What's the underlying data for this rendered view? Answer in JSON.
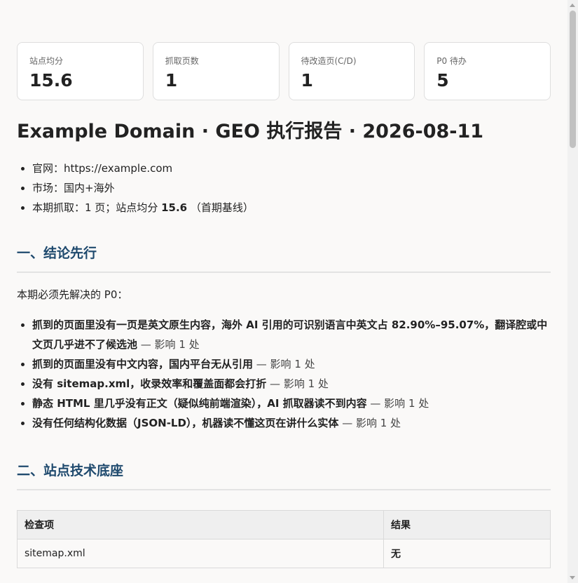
{
  "stats": [
    {
      "label": "站点均分",
      "value": "15.6"
    },
    {
      "label": "抓取页数",
      "value": "1"
    },
    {
      "label": "待改造页(C/D)",
      "value": "1"
    },
    {
      "label": "P0 待办",
      "value": "5"
    }
  ],
  "title": "Example Domain · GEO 执行报告 · 2026-08-11",
  "meta": {
    "site": "官网：https://example.com",
    "market": "市场：国内+海外",
    "crawl_prefix": "本期抓取：1 页；站点均分 ",
    "crawl_score": "15.6",
    "crawl_suffix": " （首期基线）"
  },
  "section1": {
    "heading": "一、结论先行",
    "intro": "本期必须先解决的 P0：",
    "items": [
      {
        "text": "抓到的页面里没有一页是英文原生内容，海外 AI 引用的可识别语言中英文占 82.90%–95.07%，翻译腔或中文页几乎进不了候选池",
        "impact": " — 影响 1 处"
      },
      {
        "text": "抓到的页面里没有中文内容，国内平台无从引用",
        "impact": " — 影响 1 处"
      },
      {
        "text": "没有 sitemap.xml，收录效率和覆盖面都会打折",
        "impact": " — 影响 1 处"
      },
      {
        "text": "静态 HTML 里几乎没有正文（疑似纯前端渲染），AI 抓取器读不到内容",
        "impact": " — 影响 1 处"
      },
      {
        "text": "没有任何结构化数据（JSON-LD），机器读不懂这页在讲什么实体",
        "impact": " — 影响 1 处"
      }
    ]
  },
  "section2": {
    "heading": "二、站点技术底座",
    "table": {
      "headers": [
        "检查项",
        "结果"
      ],
      "rows": [
        [
          "sitemap.xml",
          "无"
        ]
      ]
    }
  }
}
